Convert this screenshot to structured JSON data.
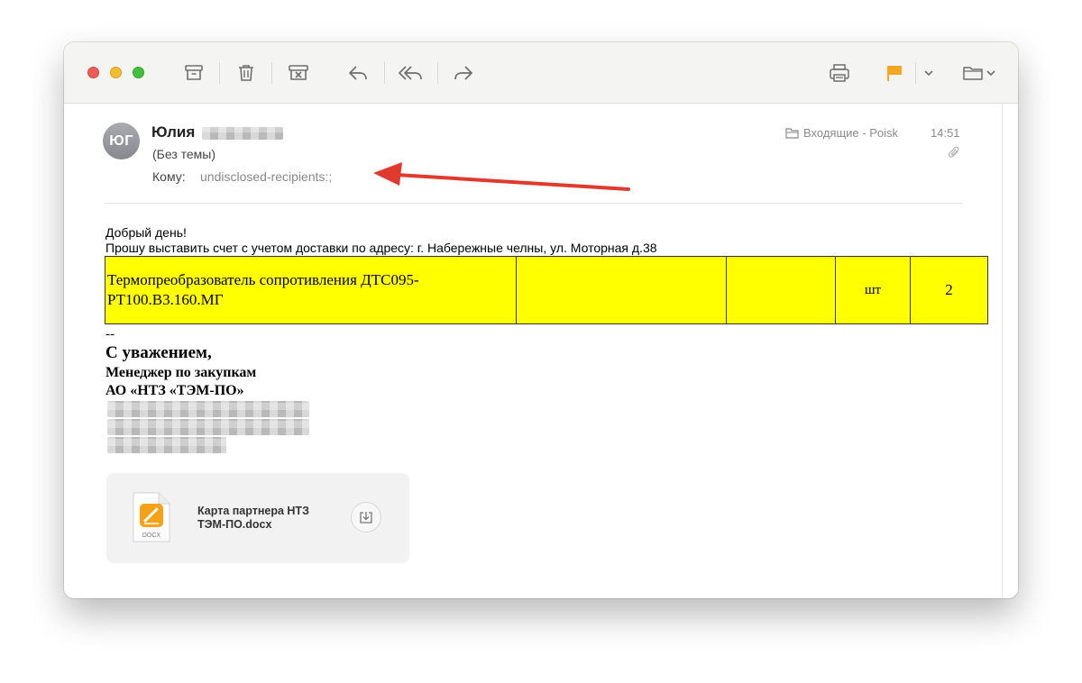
{
  "message": {
    "avatar_initials": "ЮГ",
    "sender_name": "Юлия",
    "subject": "(Без темы)",
    "to_label": "Кому:",
    "to_value": "undisclosed-recipients:;",
    "folder": "Входящие - Poisk",
    "time": "14:51"
  },
  "body": {
    "greeting": "Добрый день!",
    "request": "Прошу выставить счет с учетом доставки по адресу: г. Набережные челны, ул. Моторная д.38",
    "table": {
      "rows": [
        {
          "item": "Термопреобразователь сопротивления ДТС095-РТ100.В3.160.МГ",
          "col2": "",
          "col3": "",
          "unit": "шт",
          "qty": "2"
        }
      ],
      "highlight_color": "#ffff00"
    },
    "signature": {
      "dash": "--",
      "regards": "С уважением,",
      "position": "Менеджер по закупкам",
      "company": "АО «НТЗ «ТЭМ-ПО»"
    }
  },
  "attachment": {
    "filename": "Карта партнера НТЗ ТЭМ-ПО.docx",
    "file_type": "DOCX"
  },
  "toolbar": {
    "icons": [
      "archive-icon",
      "trash-icon",
      "junk-icon",
      "reply-icon",
      "reply-all-icon",
      "forward-icon",
      "print-icon",
      "flag-icon",
      "chevron-down-icon",
      "move-to-folder-icon"
    ],
    "flag_color": "#f5a623"
  },
  "annotation": {
    "arrow_color": "#e03a2f"
  }
}
